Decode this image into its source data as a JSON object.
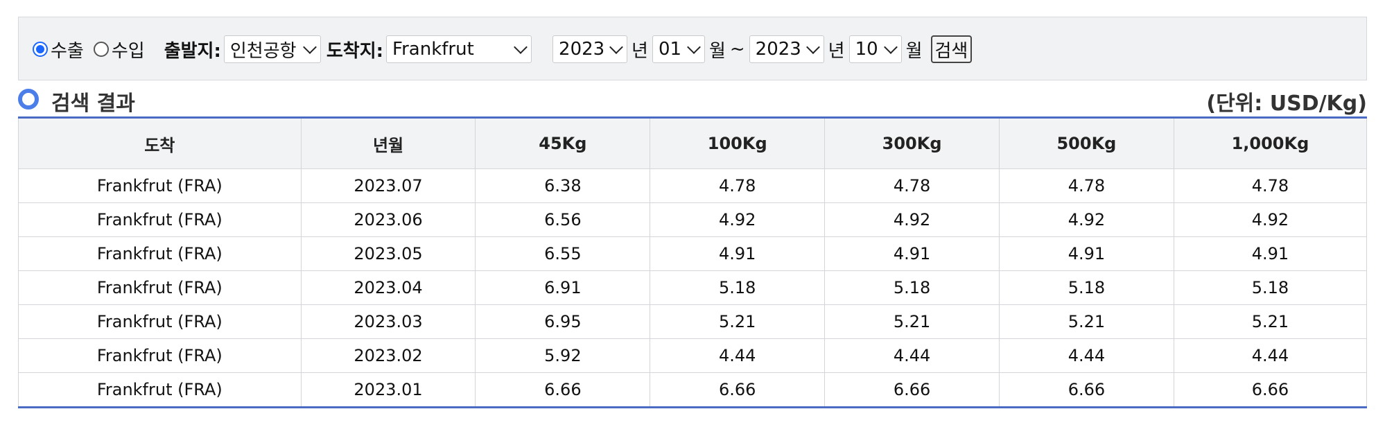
{
  "search": {
    "direction_options": [
      {
        "label": "수출",
        "checked": true
      },
      {
        "label": "수입",
        "checked": false
      }
    ],
    "origin_label": "출발지:",
    "origin_value": "인천공항",
    "destination_label": "도착지:",
    "destination_value": "Frankfrut",
    "start_year": "2023",
    "start_month": "01",
    "end_year": "2023",
    "end_month": "10",
    "year_unit": "년",
    "month_unit": "월",
    "range_sep": "~",
    "search_button": "검색"
  },
  "result": {
    "title": "검색 결과",
    "unit_note": "(단위: USD/Kg)"
  },
  "table": {
    "headers": [
      "도착",
      "년월",
      "45Kg",
      "100Kg",
      "300Kg",
      "500Kg",
      "1,000Kg"
    ],
    "rows": [
      [
        "Frankfrut (FRA)",
        "2023.07",
        "6.38",
        "4.78",
        "4.78",
        "4.78",
        "4.78"
      ],
      [
        "Frankfrut (FRA)",
        "2023.06",
        "6.56",
        "4.92",
        "4.92",
        "4.92",
        "4.92"
      ],
      [
        "Frankfrut (FRA)",
        "2023.05",
        "6.55",
        "4.91",
        "4.91",
        "4.91",
        "4.91"
      ],
      [
        "Frankfrut (FRA)",
        "2023.04",
        "6.91",
        "5.18",
        "5.18",
        "5.18",
        "5.18"
      ],
      [
        "Frankfrut (FRA)",
        "2023.03",
        "6.95",
        "5.21",
        "5.21",
        "5.21",
        "5.21"
      ],
      [
        "Frankfrut (FRA)",
        "2023.02",
        "5.92",
        "4.44",
        "4.44",
        "4.44",
        "4.44"
      ],
      [
        "Frankfrut (FRA)",
        "2023.01",
        "6.66",
        "6.66",
        "6.66",
        "6.66",
        "6.66"
      ]
    ]
  },
  "colors": {
    "accent": "#4a6bc4",
    "radio_selected": "#1a66ff",
    "searchbar_bg": "#f1f2f4"
  }
}
